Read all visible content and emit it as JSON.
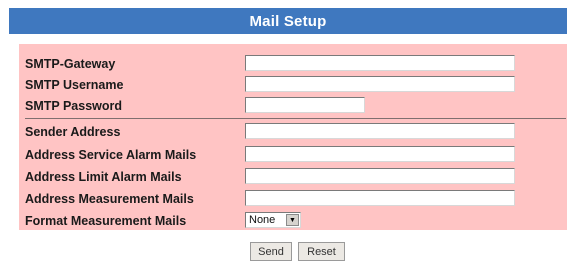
{
  "header": {
    "title": "Mail Setup"
  },
  "form": {
    "smtp_gateway": {
      "label": "SMTP-Gateway",
      "value": ""
    },
    "smtp_username": {
      "label": "SMTP Username",
      "value": ""
    },
    "smtp_password": {
      "label": "SMTP Password",
      "value": ""
    },
    "sender_address": {
      "label": "Sender Address",
      "value": ""
    },
    "address_service_alarm": {
      "label": "Address Service Alarm Mails",
      "value": ""
    },
    "address_limit_alarm": {
      "label": "Address Limit Alarm Mails",
      "value": ""
    },
    "address_measurement": {
      "label": "Address Measurement Mails",
      "value": ""
    },
    "format_measurement": {
      "label": "Format Measurement Mails",
      "selected": "None"
    }
  },
  "buttons": {
    "send": "Send",
    "reset": "Reset"
  },
  "colors": {
    "header_bg": "#3f78bf",
    "panel_bg": "#ffc4c4"
  }
}
